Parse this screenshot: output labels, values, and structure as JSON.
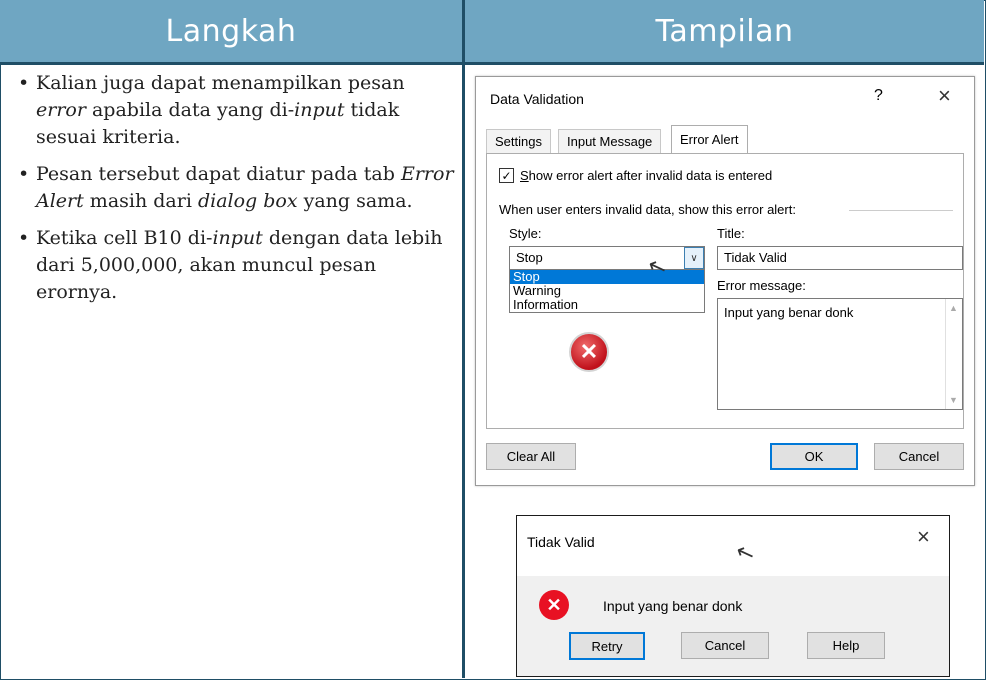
{
  "headers": {
    "left": "Langkah",
    "right": "Tampilan"
  },
  "steps": {
    "s1_a": "Kalian juga dapat menampilkan pesan ",
    "s1_b": "error",
    "s1_c": " apabila data yang di-",
    "s1_d": "input",
    "s1_e": " tidak sesuai kriteria.",
    "s2_a": "Pesan tersebut dapat diatur pada tab ",
    "s2_b": "Error Alert",
    "s2_c": " masih dari ",
    "s2_d": "dialog box",
    "s2_e": " yang sama.",
    "s3_a": "Ketika cell B10 di-",
    "s3_b": "input",
    "s3_c": " dengan data lebih dari 5,000,000,  akan muncul pesan erornya."
  },
  "dialog1": {
    "title": "Data Validation",
    "help": "?",
    "close": "×",
    "tabs": [
      "Settings",
      "Input Message",
      "Error Alert"
    ],
    "checkbox_mark": "✓",
    "checkbox_label": "Show error alert after invalid data is entered",
    "group_label": "When user enters invalid data, show this error alert:",
    "style_label": "Style:",
    "style_value": "Stop",
    "style_options": [
      "Stop",
      "Warning",
      "Information"
    ],
    "title_label": "Title:",
    "title_value": "Tidak Valid",
    "message_label": "Error message:",
    "message_value": "Input yang benar donk",
    "buttons": {
      "clear": "Clear All",
      "ok": "OK",
      "cancel": "Cancel"
    }
  },
  "dialog2": {
    "title": "Tidak Valid",
    "close": "×",
    "message": "Input yang benar donk",
    "buttons": {
      "retry": "Retry",
      "cancel": "Cancel",
      "help": "Help"
    }
  },
  "icons": {
    "stop": "stop-error-icon",
    "cursor": "mouse-cursor-icon"
  },
  "colors": {
    "header_bg": "#6fa6c2",
    "border": "#1f4e66",
    "selection": "#0078d7",
    "error_red": "#e81123"
  }
}
